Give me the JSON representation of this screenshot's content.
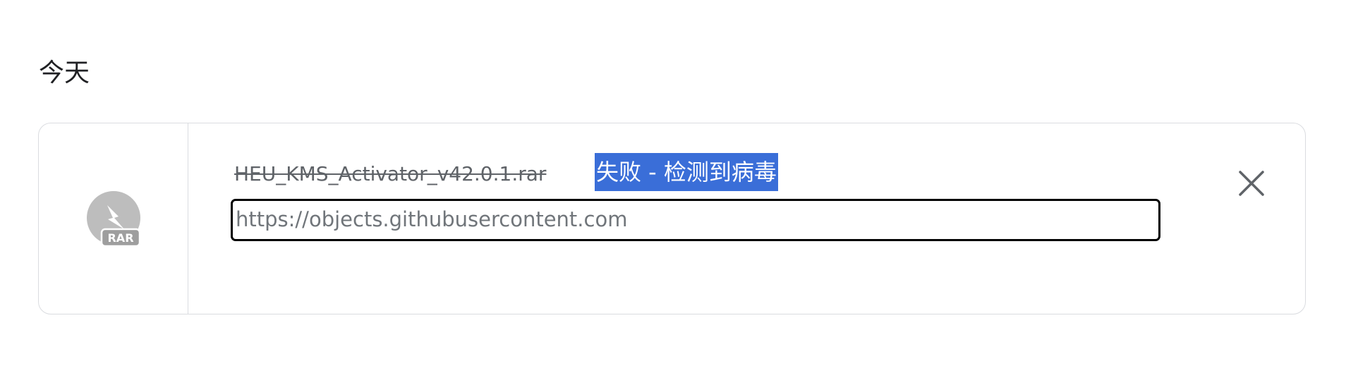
{
  "section": {
    "date_label": "今天"
  },
  "download": {
    "file_name": "HEU_KMS_Activator_v42.0.1.rar",
    "status": "失败 - 检测到病毒",
    "url": "https://objects.githubusercontent.com",
    "icon": "rar-file-icon",
    "icon_label": "RAR",
    "close_icon": "close-icon"
  },
  "colors": {
    "status_background": "#3a6ed8",
    "status_text": "#ffffff",
    "file_name_text": "#5f6368",
    "url_text": "#70757a",
    "card_border": "#dadce0",
    "focus_border": "#000000"
  }
}
